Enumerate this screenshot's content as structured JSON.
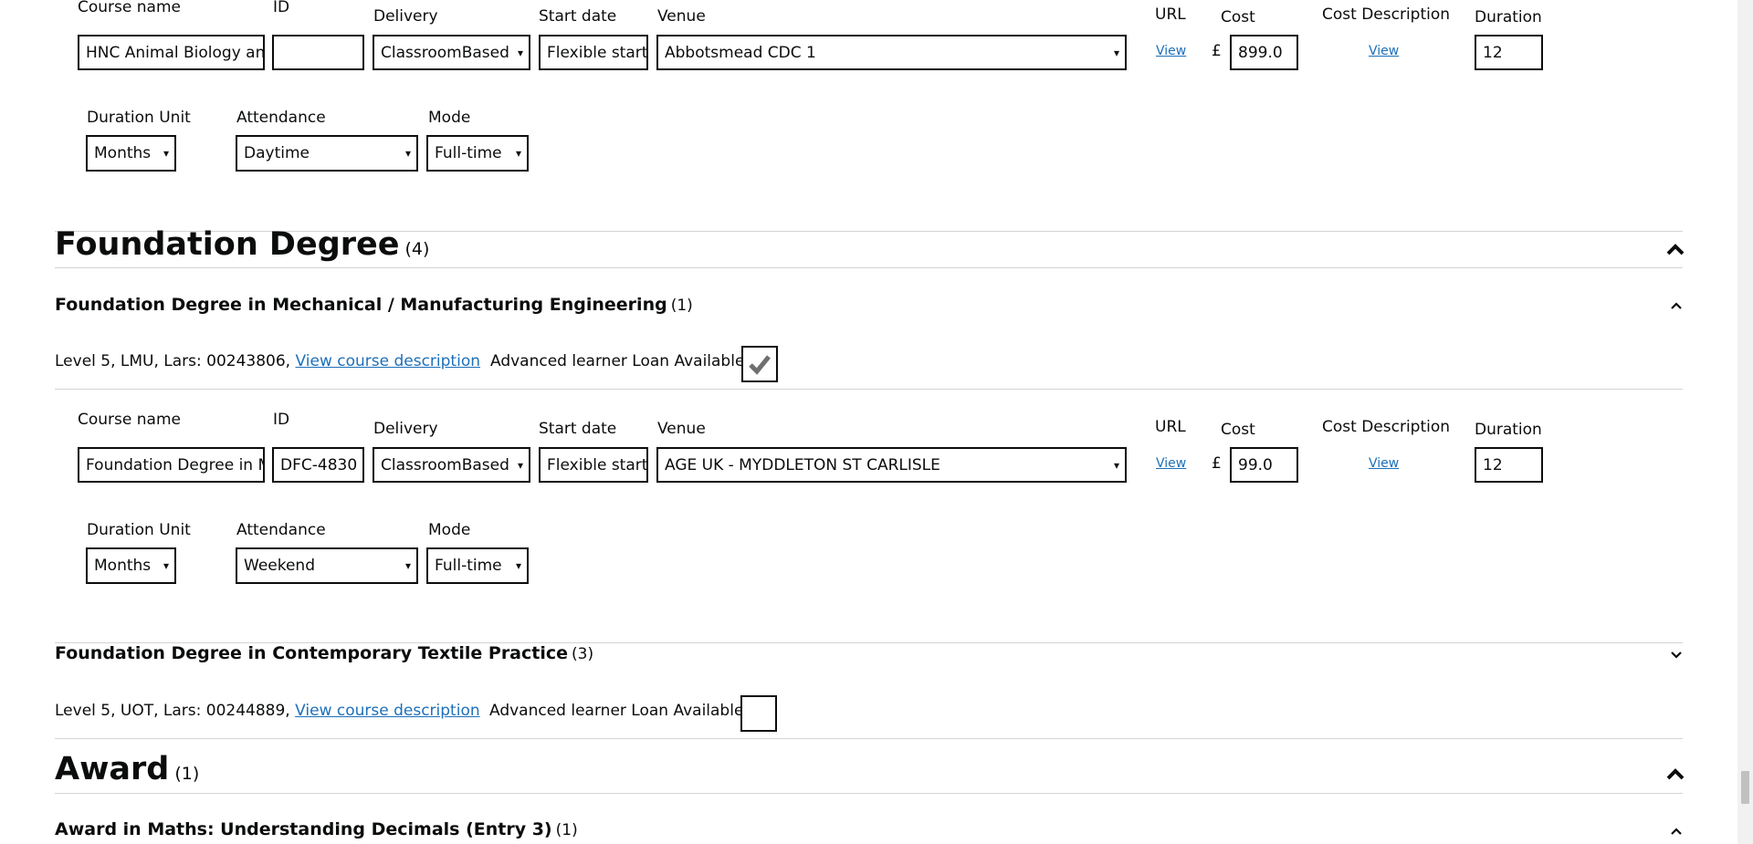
{
  "field_labels": {
    "course_name": "Course name",
    "id": "ID",
    "delivery": "Delivery",
    "start_date": "Start date",
    "venue": "Venue",
    "url": "URL",
    "cost": "Cost",
    "cost_description": "Cost Description",
    "duration": "Duration",
    "duration_unit": "Duration Unit",
    "attendance": "Attendance",
    "mode": "Mode",
    "currency": "£",
    "view_link": "View"
  },
  "offering1": {
    "course_name": "HNC Animal Biology and",
    "id": "",
    "delivery": "ClassroomBased",
    "start_date": "Flexible start",
    "venue": "Abbotsmead CDC 1",
    "cost": "899.0",
    "duration": "12",
    "duration_unit": "Months",
    "attendance": "Daytime",
    "mode": "Full-time"
  },
  "category_foundation": {
    "title": "Foundation Degree",
    "count": "(4)"
  },
  "course_fd_mech": {
    "title": "Foundation Degree in Mechanical / Manufacturing Engineering",
    "count": "(1)",
    "meta": "Level 5, LMU, Lars: 00243806,",
    "description_link": "View course description",
    "loan_label": "Advanced learner Loan Available",
    "loan_available": true
  },
  "offering2": {
    "course_name": "Foundation Degree in M",
    "id": "DFC-4830",
    "delivery": "ClassroomBased",
    "start_date": "Flexible start",
    "venue": "AGE UK - MYDDLETON ST CARLISLE",
    "cost": "99.0",
    "duration": "12",
    "duration_unit": "Months",
    "attendance": "Weekend",
    "mode": "Full-time"
  },
  "course_fd_textile": {
    "title": "Foundation Degree in Contemporary Textile Practice",
    "count": "(3)",
    "meta": "Level 5, UOT, Lars: 00244889,",
    "description_link": "View course description",
    "loan_label": "Advanced learner Loan Available",
    "loan_available": false
  },
  "category_award": {
    "title": "Award",
    "count": "(1)"
  },
  "course_award_maths": {
    "title": "Award in Maths: Understanding Decimals (Entry 3)",
    "count": "(1)"
  },
  "icons": {
    "chevron_up": "chevron-up-icon",
    "chevron_down": "chevron-down-icon",
    "checkmark": "checkmark-icon"
  }
}
